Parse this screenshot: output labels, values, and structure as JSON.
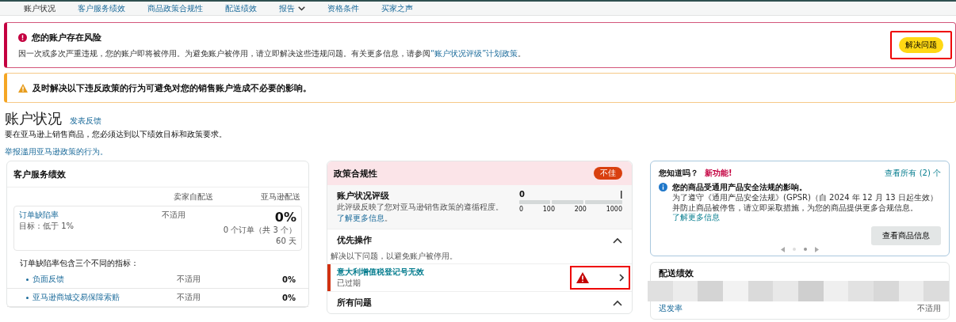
{
  "nav": [
    {
      "label": "账户状况",
      "selected": true,
      "has_menu": false
    },
    {
      "label": "客户服务绩效",
      "selected": false,
      "has_menu": false
    },
    {
      "label": "商品政策合规性",
      "selected": false,
      "has_menu": false
    },
    {
      "label": "配送绩效",
      "selected": false,
      "has_menu": false
    },
    {
      "label": "报告",
      "selected": false,
      "has_menu": true
    },
    {
      "label": "资格条件",
      "selected": false,
      "has_menu": false
    },
    {
      "label": "买家之声",
      "selected": false,
      "has_menu": false
    }
  ],
  "alert": {
    "title": "您的账户存在风险",
    "text": "因一次或多次严重违规，您的账户即将被停用。为避免账户被停用，请立即解决这些违规问题。有关更多信息，请参阅",
    "link": "“账户状况评级”计划政策",
    "text_end": "。",
    "button": "解决问题"
  },
  "warning": {
    "text": "及时解决以下违反政策的行为可避免对您的销售账户造成不必要的影响。"
  },
  "header": {
    "title": "账户状况",
    "feedback_link": "发表反馈",
    "subtitle": "要在亚马逊上销售商品，您必须达到以下绩效目标和政策要求。",
    "report_link": "举报滥用亚马逊政策的行为。"
  },
  "customer_service": {
    "title": "客户服务绩效",
    "columns": [
      "卖家自配送",
      "亚马逊配送"
    ],
    "metric": {
      "name": "订单缺陷率",
      "target": "目标：低于 1%",
      "merchant": "不适用",
      "amazon_value": "0%",
      "amazon_orders": "0 个订单（共 3 个）",
      "amazon_period": "60 天"
    },
    "note": "订单缺陷率包含三个不同的指标：",
    "sub_metrics": [
      {
        "name": "负面反馈",
        "merchant": "不适用",
        "amazon": "0%"
      },
      {
        "name": "亚马逊商城交易保障索赔",
        "merchant": "不适用",
        "amazon": "0%"
      }
    ]
  },
  "policy": {
    "title": "政策合规性",
    "badge": "不佳",
    "rating": {
      "title": "账户状况评级",
      "text": "此评级反映了您对亚马逊销售政策的遵循程度。",
      "link": "了解更多信息",
      "text_end": "。",
      "value": "0",
      "scale": [
        "0",
        "100",
        "200",
        "1000"
      ]
    },
    "priority": {
      "title": "优先操作",
      "expanded": true,
      "note": "解决以下问题，以避免账户被停用。",
      "issues": [
        {
          "title": "意大利增值税登记号无效",
          "status": "已过期"
        }
      ]
    },
    "all_issues": {
      "title": "所有问题",
      "expanded": true
    }
  },
  "tips": {
    "title": "您知道吗？",
    "badge": "新功能!",
    "view_all": "查看所有 (2) 个",
    "notice_title": "您的商品受通用产品安全法规的影响。",
    "notice_text": "为了遵守《通用产品安全法规》(GPSR)（自 2024 年 12 月 13 日起生效）并防止商品被停售，请立即采取措施，为您的商品提供更多合规信息。",
    "notice_link": "了解更多信息",
    "button": "查看商品信息",
    "pages": [
      {
        "selected": false
      },
      {
        "selected": true
      }
    ]
  },
  "shipping": {
    "title": "配送绩效",
    "rows": [
      {
        "name": "迟发率",
        "value": "不适用"
      }
    ]
  }
}
